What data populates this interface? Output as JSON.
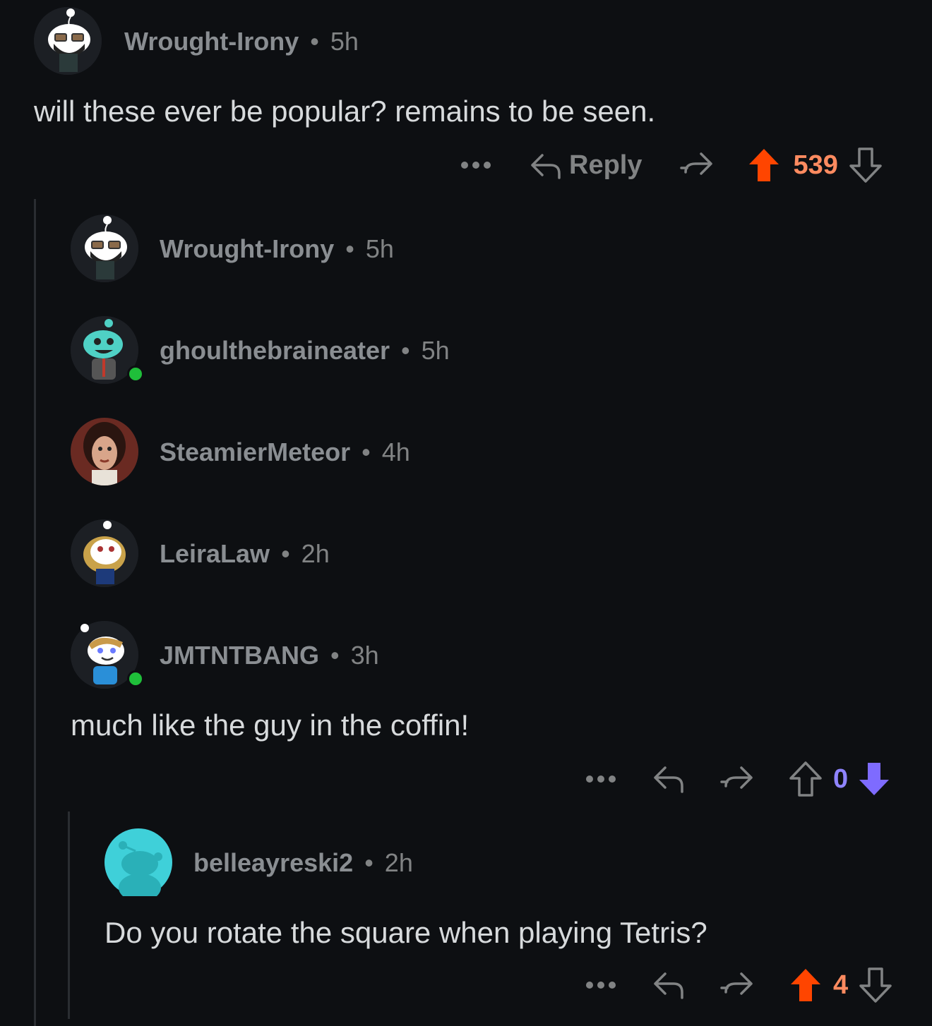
{
  "colors": {
    "background": "#0d0f12",
    "upvote_active": "#ff4500",
    "score_up": "#ff8b60",
    "downvote_active": "#7e6bff",
    "score_down": "#8f84ff",
    "muted": "#818384",
    "online": "#1fbf3a"
  },
  "comments": [
    {
      "username": "Wrought-Irony",
      "time": "5h",
      "text": "will these ever be popular? remains to be seen.",
      "reply_label": "Reply",
      "score": "539",
      "vote": "up",
      "avatar_icon": "snoo-avatar-glasses-beard-icon"
    },
    {
      "username": "Wrought-Irony",
      "time": "5h",
      "collapsed": true,
      "avatar_icon": "snoo-avatar-glasses-beard-icon"
    },
    {
      "username": "ghoulthebraineater",
      "time": "5h",
      "collapsed": true,
      "online": true,
      "avatar_icon": "snoo-avatar-zombie-icon"
    },
    {
      "username": "SteamierMeteor",
      "time": "4h",
      "collapsed": true,
      "avatar_icon": "photo-avatar-icon"
    },
    {
      "username": "LeiraLaw",
      "time": "2h",
      "collapsed": true,
      "avatar_icon": "snoo-avatar-blonde-icon"
    },
    {
      "username": "JMTNTBANG",
      "time": "3h",
      "text": "much like the guy in the coffin!",
      "score": "0",
      "vote": "down",
      "online": true,
      "avatar_icon": "snoo-avatar-blue-shirt-icon"
    },
    {
      "username": "belleayreski2",
      "time": "2h",
      "text": "Do you rotate the square when playing Tetris?",
      "score": "4",
      "vote": "up",
      "avatar_icon": "default-snoo-avatar-icon"
    }
  ],
  "separator": "•"
}
